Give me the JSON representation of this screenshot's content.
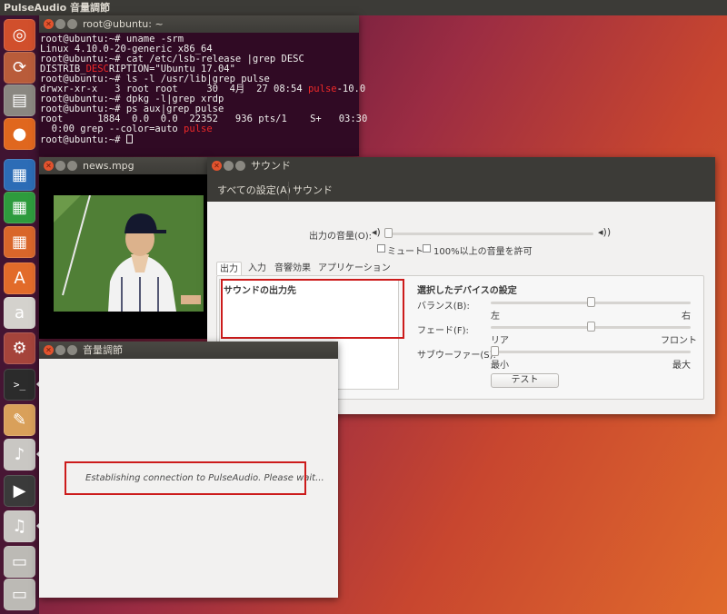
{
  "top_panel": {
    "title": "PulseAudio 音量調節"
  },
  "launcher": {
    "items": [
      {
        "name": "ubuntu-dash-icon",
        "glyph": "◎",
        "color": "#d14f2c"
      },
      {
        "name": "software-updater-icon",
        "glyph": "⟳",
        "color": "#b95c3a"
      },
      {
        "name": "files-icon",
        "glyph": "▤",
        "color": "#8a8781"
      },
      {
        "name": "firefox-icon",
        "glyph": "●",
        "color": "#e0671e"
      },
      {
        "name": "libreoffice-writer-icon",
        "glyph": "▦",
        "color": "#2c6cb6"
      },
      {
        "name": "libreoffice-calc-icon",
        "glyph": "▦",
        "color": "#2e9b3d"
      },
      {
        "name": "libreoffice-impress-icon",
        "glyph": "▦",
        "color": "#d9662a"
      },
      {
        "name": "ubuntu-software-icon",
        "glyph": "A",
        "color": "#e26b2a"
      },
      {
        "name": "amazon-icon",
        "glyph": "a",
        "color": "#d4d2cd"
      },
      {
        "name": "system-settings-icon",
        "glyph": "⚙",
        "color": "#a5443b"
      },
      {
        "name": "terminal-icon",
        "glyph": ">_",
        "color": "#2b2b2b"
      },
      {
        "name": "text-editor-icon",
        "glyph": "✎",
        "color": "#d9a05a"
      },
      {
        "name": "audacious-icon",
        "glyph": "♪",
        "color": "#c9c7c3"
      },
      {
        "name": "video-player-icon",
        "glyph": "▶",
        "color": "#3a3a3a"
      },
      {
        "name": "audio-player-icon",
        "glyph": "♫",
        "color": "#c9c7c3"
      },
      {
        "name": "drive-icon",
        "glyph": "▭",
        "color": "#bcbab5"
      },
      {
        "name": "drive-icon-2",
        "glyph": "▭",
        "color": "#bcbab5"
      }
    ]
  },
  "terminal": {
    "title": "root@ubuntu: ~",
    "lines": {
      "l1": "root@ubuntu:~# uname -srm",
      "l2": "Linux 4.10.0-20-generic x86_64",
      "l3": "root@ubuntu:~# cat /etc/lsb-release |grep DESC",
      "l4a": "DISTRIB_",
      "l4b": "DESC",
      "l4c": "RIPTION=\"Ubuntu 17.04\"",
      "l5": "root@ubuntu:~# ls -l /usr/lib|grep pulse",
      "l6a": "drwxr-xr-x   3 root root     30  4月  27 08:54 ",
      "l6b": "pulse",
      "l6c": "-10.0",
      "l7": "root@ubuntu:~# dpkg -l|grep xrdp",
      "l8": "root@ubuntu:~# ps aux|grep pulse",
      "l9": "root      1884  0.0  0.0  22352   936 pts/1    S+   03:30",
      "l10a": "  0:00 grep --color=auto ",
      "l10b": "pulse",
      "l11": "root@ubuntu:~# "
    }
  },
  "video": {
    "title": "news.mpg"
  },
  "sound": {
    "title": "サウンド",
    "toolbar": {
      "all_settings": "すべての設定(A)",
      "sound": "サウンド"
    },
    "output_volume_label": "出力の音量(O):",
    "mute_label": "ミュート",
    "allow_over_label": "100%以上の音量を許可",
    "tabs": [
      "出力",
      "入力",
      "音響効果",
      "アプリケーション"
    ],
    "output_dest_header": "サウンドの出力先",
    "device_settings_header": "選択したデバイスの設定",
    "balance_label": "バランス(B):",
    "balance_left": "左",
    "balance_right": "右",
    "fade_label": "フェード(F):",
    "fade_rear": "リア",
    "fade_front": "フロント",
    "subwoofer_label": "サブウーファー(S):",
    "sub_min": "最小",
    "sub_max": "最大",
    "test_button": "テスト",
    "balance_value": 0.5,
    "fade_value": 0.5,
    "subwoofer_value": 0.0,
    "output_volume_value": 0.0
  },
  "volume_control": {
    "title": "音量調節",
    "status": "Establishing connection to PulseAudio. Please wait..."
  },
  "colors": {
    "highlight": "#cc1b1b",
    "terminal_bg": "#300a24",
    "accent": "#e2532e"
  }
}
